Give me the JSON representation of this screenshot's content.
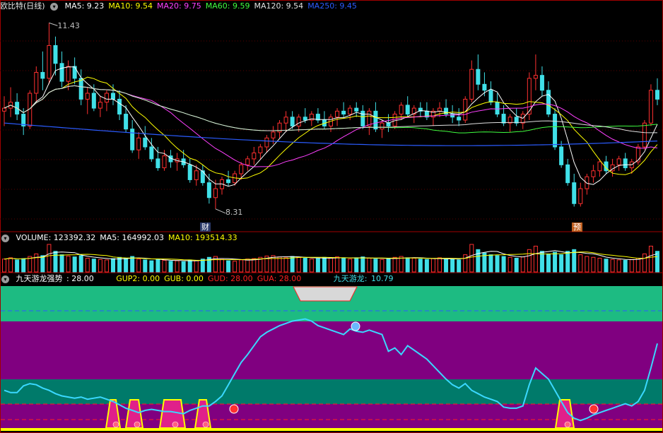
{
  "main_panel": {
    "title": "欧比特(日线)",
    "indicators": [
      {
        "label": "MA5:",
        "value": "9.23",
        "color": "#ffffff"
      },
      {
        "label": "MA10:",
        "value": "9.54",
        "color": "#ffff00"
      },
      {
        "label": "MA20:",
        "value": "9.75",
        "color": "#ff40ff"
      },
      {
        "label": "MA60:",
        "value": "9.59",
        "color": "#40ff40"
      },
      {
        "label": "MA120:",
        "value": "9.54",
        "color": "#e0e0e0"
      },
      {
        "label": "MA250:",
        "value": "9.45",
        "color": "#2b5cff"
      }
    ],
    "high_label": "11.43",
    "low_label": "8.31",
    "tag_cai": "财",
    "tag_yu": "预"
  },
  "volume_panel": {
    "items": [
      {
        "label": "VOLUME:",
        "value": "123392.32",
        "color": "#ffffff"
      },
      {
        "label": "MA5:",
        "value": "164992.03",
        "color": "#ffffff"
      },
      {
        "label": "MA10:",
        "value": "193514.33",
        "color": "#ffff00"
      }
    ]
  },
  "indicator_panel": {
    "title": "九天游龙强势",
    "title_value": ": 28.00",
    "items": [
      {
        "label": "GUP2:",
        "value": "0.00",
        "color": "#ffff00"
      },
      {
        "label": "GUB:",
        "value": "0.00",
        "color": "#ffff00"
      },
      {
        "label": "GUD:",
        "value": "28.00",
        "color": "#ff2020"
      },
      {
        "label": "GUA:",
        "value": "28.00",
        "color": "#ff2020"
      }
    ],
    "line_label": "九天游龙:",
    "line_value": "10.79"
  },
  "colors": {
    "up": "#ff3030",
    "down": "#40e0e8",
    "background": "#000000",
    "band_green": "#1dbb82",
    "band_purple": "#800080",
    "band_teal": "#007a6a"
  },
  "chart_data": [
    {
      "type": "candlestick",
      "title": "欧比特(日线)",
      "ylim": [
        8.0,
        11.6
      ],
      "labels": [
        "11.43",
        "8.31"
      ],
      "series": [
        {
          "name": "MA5",
          "last": 9.23
        },
        {
          "name": "MA10",
          "last": 9.54
        },
        {
          "name": "MA20",
          "last": 9.75
        },
        {
          "name": "MA60",
          "last": 9.59
        },
        {
          "name": "MA120",
          "last": 9.54
        },
        {
          "name": "MA250",
          "last": 9.45
        }
      ],
      "candles": [
        [
          0,
          9.95,
          10.2,
          9.7,
          10.0
        ],
        [
          1,
          10.0,
          10.35,
          9.85,
          10.1
        ],
        [
          2,
          10.1,
          10.25,
          9.8,
          9.9
        ],
        [
          3,
          9.9,
          10.0,
          9.55,
          9.7
        ],
        [
          4,
          9.7,
          10.3,
          9.65,
          10.25
        ],
        [
          5,
          10.25,
          10.7,
          10.1,
          10.6
        ],
        [
          6,
          10.6,
          10.95,
          10.3,
          10.5
        ],
        [
          7,
          10.5,
          11.43,
          10.4,
          11.05
        ],
        [
          8,
          11.05,
          11.2,
          10.55,
          10.75
        ],
        [
          9,
          10.75,
          10.95,
          10.35,
          10.45
        ],
        [
          10,
          10.45,
          10.8,
          10.3,
          10.7
        ],
        [
          11,
          10.7,
          10.85,
          10.4,
          10.5
        ],
        [
          12,
          10.5,
          10.65,
          10.05,
          10.15
        ],
        [
          13,
          10.15,
          10.35,
          9.9,
          10.25
        ],
        [
          14,
          10.25,
          10.4,
          9.95,
          10.0
        ],
        [
          15,
          10.0,
          10.2,
          9.85,
          10.1
        ],
        [
          16,
          10.1,
          10.3,
          9.95,
          10.25
        ],
        [
          17,
          10.25,
          10.4,
          10.05,
          10.15
        ],
        [
          18,
          10.15,
          10.3,
          9.8,
          9.9
        ],
        [
          19,
          9.9,
          10.05,
          9.6,
          9.65
        ],
        [
          20,
          9.65,
          9.8,
          9.25,
          9.3
        ],
        [
          21,
          9.3,
          9.6,
          9.15,
          9.5
        ],
        [
          22,
          9.5,
          9.7,
          9.3,
          9.35
        ],
        [
          23,
          9.35,
          9.5,
          9.1,
          9.15
        ],
        [
          24,
          9.15,
          9.35,
          8.95,
          9.0
        ],
        [
          25,
          9.0,
          9.3,
          8.95,
          9.2
        ],
        [
          26,
          9.2,
          9.3,
          9.0,
          9.1
        ],
        [
          27,
          9.1,
          9.25,
          8.95,
          9.15
        ],
        [
          28,
          9.15,
          9.3,
          9.0,
          9.05
        ],
        [
          29,
          9.05,
          9.15,
          8.75,
          8.8
        ],
        [
          30,
          8.8,
          9.05,
          8.7,
          8.95
        ],
        [
          31,
          8.95,
          9.05,
          8.7,
          8.75
        ],
        [
          32,
          8.75,
          8.9,
          8.4,
          8.5
        ],
        [
          33,
          8.5,
          8.8,
          8.31,
          8.65
        ],
        [
          34,
          8.65,
          8.85,
          8.55,
          8.8
        ],
        [
          35,
          8.8,
          8.95,
          8.7,
          8.75
        ],
        [
          36,
          8.75,
          8.95,
          8.7,
          8.9
        ],
        [
          37,
          8.9,
          9.1,
          8.8,
          9.05
        ],
        [
          38,
          9.05,
          9.2,
          8.95,
          9.15
        ],
        [
          39,
          9.15,
          9.35,
          9.05,
          9.25
        ],
        [
          40,
          9.25,
          9.4,
          9.15,
          9.35
        ],
        [
          41,
          9.35,
          9.55,
          9.25,
          9.5
        ],
        [
          42,
          9.5,
          9.7,
          9.4,
          9.6
        ],
        [
          43,
          9.6,
          9.8,
          9.5,
          9.75
        ],
        [
          44,
          9.75,
          9.95,
          9.6,
          9.85
        ],
        [
          45,
          9.85,
          9.95,
          9.65,
          9.7
        ],
        [
          46,
          9.7,
          9.9,
          9.6,
          9.85
        ],
        [
          47,
          9.85,
          10.0,
          9.75,
          9.8
        ],
        [
          48,
          9.8,
          9.95,
          9.7,
          9.9
        ],
        [
          49,
          9.9,
          10.0,
          9.75,
          9.8
        ],
        [
          50,
          9.8,
          9.95,
          9.65,
          9.7
        ],
        [
          51,
          9.7,
          9.9,
          9.6,
          9.85
        ],
        [
          52,
          9.85,
          10.0,
          9.7,
          9.95
        ],
        [
          53,
          9.95,
          10.1,
          9.85,
          9.9
        ],
        [
          54,
          9.9,
          10.05,
          9.8,
          10.0
        ],
        [
          55,
          10.0,
          10.1,
          9.85,
          9.95
        ],
        [
          56,
          9.95,
          10.05,
          9.65,
          9.7
        ],
        [
          57,
          9.7,
          10.0,
          9.55,
          9.95
        ],
        [
          58,
          9.95,
          10.1,
          9.6,
          9.65
        ],
        [
          59,
          9.65,
          9.8,
          9.5,
          9.75
        ],
        [
          60,
          9.75,
          9.9,
          9.6,
          9.7
        ],
        [
          61,
          9.7,
          9.95,
          9.65,
          9.9
        ],
        [
          62,
          9.9,
          10.1,
          9.8,
          10.05
        ],
        [
          63,
          10.05,
          10.2,
          9.85,
          9.9
        ],
        [
          64,
          9.9,
          10.05,
          9.75,
          10.0
        ],
        [
          65,
          10.0,
          10.1,
          9.85,
          9.95
        ],
        [
          66,
          9.95,
          10.1,
          9.8,
          9.85
        ],
        [
          67,
          9.85,
          10.0,
          9.7,
          9.95
        ],
        [
          68,
          9.95,
          10.1,
          9.85,
          10.0
        ],
        [
          69,
          10.0,
          10.15,
          9.85,
          9.9
        ],
        [
          70,
          9.9,
          10.05,
          9.75,
          9.85
        ],
        [
          71,
          9.85,
          10.0,
          9.7,
          9.8
        ],
        [
          72,
          9.8,
          10.2,
          9.75,
          10.15
        ],
        [
          73,
          10.15,
          10.8,
          10.1,
          10.65
        ],
        [
          74,
          10.65,
          10.9,
          10.3,
          10.4
        ],
        [
          75,
          10.4,
          10.6,
          10.2,
          10.3
        ],
        [
          76,
          10.3,
          10.45,
          10.05,
          10.1
        ],
        [
          77,
          10.1,
          10.25,
          9.85,
          9.9
        ],
        [
          78,
          9.9,
          10.05,
          9.7,
          9.75
        ],
        [
          79,
          9.75,
          9.9,
          9.6,
          9.85
        ],
        [
          80,
          9.85,
          10.0,
          9.7,
          9.75
        ],
        [
          81,
          9.75,
          9.95,
          9.65,
          9.9
        ],
        [
          82,
          9.9,
          10.6,
          9.8,
          10.5
        ],
        [
          83,
          10.5,
          10.9,
          10.3,
          10.55
        ],
        [
          84,
          10.55,
          10.7,
          10.2,
          10.3
        ],
        [
          85,
          10.3,
          10.45,
          9.85,
          9.9
        ],
        [
          86,
          9.9,
          10.0,
          9.3,
          9.35
        ],
        [
          87,
          9.35,
          9.45,
          9.0,
          9.05
        ],
        [
          88,
          9.05,
          9.15,
          8.7,
          8.75
        ],
        [
          89,
          8.75,
          8.9,
          8.35,
          8.4
        ],
        [
          90,
          8.4,
          8.75,
          8.35,
          8.65
        ],
        [
          91,
          8.65,
          8.9,
          8.55,
          8.85
        ],
        [
          92,
          8.85,
          9.05,
          8.75,
          8.95
        ],
        [
          93,
          8.95,
          9.15,
          8.85,
          9.1
        ],
        [
          94,
          9.1,
          9.2,
          8.9,
          8.95
        ],
        [
          95,
          8.95,
          9.15,
          8.85,
          9.05
        ],
        [
          96,
          9.05,
          9.2,
          8.95,
          9.15
        ],
        [
          97,
          9.15,
          9.25,
          8.95,
          9.0
        ],
        [
          98,
          9.0,
          9.15,
          8.9,
          9.1
        ],
        [
          99,
          9.1,
          9.4,
          9.05,
          9.35
        ],
        [
          100,
          9.35,
          9.8,
          9.3,
          9.75
        ],
        [
          101,
          9.75,
          10.4,
          9.7,
          10.3
        ],
        [
          102,
          10.3,
          10.5,
          10.05,
          10.15
        ]
      ]
    },
    {
      "type": "bar",
      "title": "VOLUME",
      "series": [
        {
          "name": "VOLUME",
          "last": 123392.32
        },
        {
          "name": "MA5",
          "last": 164992.03
        },
        {
          "name": "MA10",
          "last": 193514.33
        }
      ],
      "values": [
        150,
        165,
        140,
        155,
        180,
        210,
        190,
        320,
        240,
        200,
        185,
        175,
        190,
        160,
        150,
        145,
        140,
        155,
        170,
        160,
        180,
        150,
        140,
        130,
        150,
        135,
        125,
        130,
        120,
        140,
        135,
        150,
        170,
        180,
        145,
        130,
        125,
        140,
        150,
        155,
        170,
        185,
        190,
        175,
        165,
        180,
        170,
        160,
        150,
        155,
        170,
        165,
        175,
        160,
        150,
        165,
        175,
        160,
        150,
        145,
        155,
        170,
        180,
        165,
        160,
        150,
        145,
        155,
        165,
        150,
        145,
        140,
        200,
        320,
        260,
        220,
        200,
        190,
        180,
        170,
        160,
        175,
        260,
        300,
        240,
        210,
        230,
        200,
        240,
        260,
        200,
        180,
        170,
        160,
        150,
        145,
        140,
        135,
        145,
        160,
        210,
        300,
        240
      ]
    },
    {
      "type": "line",
      "title": "九天游龙强势",
      "ylim": [
        0,
        100
      ],
      "series": [
        {
          "name": "九天游龙",
          "values": [
            30,
            28,
            28,
            34,
            36,
            35,
            32,
            30,
            27,
            25,
            24,
            23,
            24,
            22,
            23,
            24,
            22,
            20,
            17,
            14,
            12,
            10,
            12,
            13,
            12,
            11,
            11,
            10,
            9,
            12,
            14,
            16,
            16,
            20,
            25,
            35,
            45,
            55,
            62,
            70,
            78,
            82,
            85,
            88,
            90,
            92,
            93,
            94,
            92,
            88,
            86,
            84,
            82,
            80,
            85,
            83,
            82,
            84,
            82,
            80,
            65,
            68,
            62,
            70,
            66,
            62,
            58,
            52,
            46,
            40,
            35,
            32,
            36,
            30,
            27,
            24,
            22,
            20,
            15,
            14,
            14,
            16,
            35,
            50,
            45,
            40,
            30,
            20,
            10,
            5,
            3,
            5,
            8,
            10,
            12,
            14,
            16,
            18,
            16,
            20,
            30,
            50,
            72
          ]
        }
      ]
    }
  ]
}
